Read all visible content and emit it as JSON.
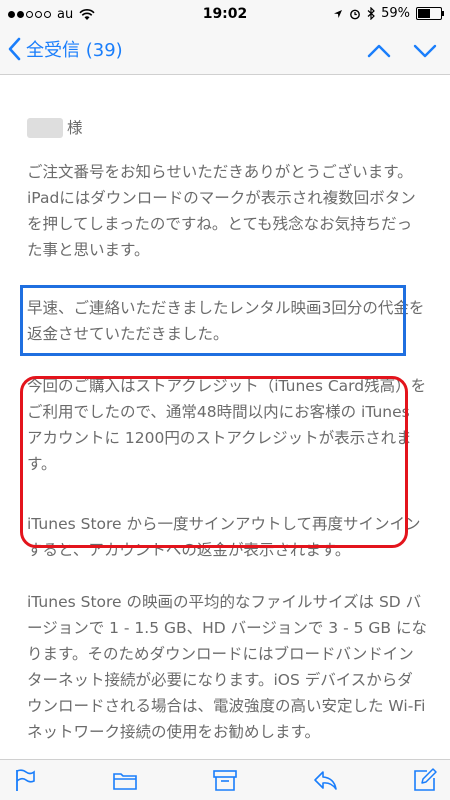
{
  "status": {
    "carrier": "au",
    "time": "19:02",
    "battery": "59%",
    "battery_level": 0.59
  },
  "nav": {
    "back_label": "全受信 (39)",
    "icons": [
      "chevron-left-icon",
      "chevron-up-icon",
      "chevron-down-icon"
    ]
  },
  "email": {
    "greeting_suffix": "様",
    "paragraphs": [
      "ご注文番号をお知らせいただきありがとうございます。",
      "iPadにはダウンロードのマークが表示され複数回ボタンを押してしまったのですね。とても残念なお気持ちだった事と思います。",
      "早速、ご連絡いただきましたレンタル映画3回分の代金を返金させていただきました。",
      "今回のご購入はストアクレジット（iTunes Card残高）をご利用でしたので、通常48時間以内にお客様の iTunes アカウントに 1200円のストアクレジットが表示されます。",
      "iTunes Store から一度サインアウトして再度サインインすると、アカウントへの返金が表示されます。",
      "iTunes Store の映画の平均的なファイルサイズは SD バージョンで 1 - 1.5 GB、HD バージョンで 3 - 5 GB になります。そのためダウンロードにはブロードバンドインターネット接続が必要になります。iOS デバイスからダウンロードされる場合は、電波強度の高い安定した Wi-Fi ネットワーク接続の使用をお勧めします。"
    ]
  },
  "toolbar": {
    "icons": [
      "flag-icon",
      "folder-icon",
      "archive-icon",
      "reply-icon",
      "compose-icon"
    ]
  },
  "colors": {
    "accent": "#1a7efb",
    "highlight_blue": "#1f6fe0",
    "highlight_red": "#e3141c"
  }
}
